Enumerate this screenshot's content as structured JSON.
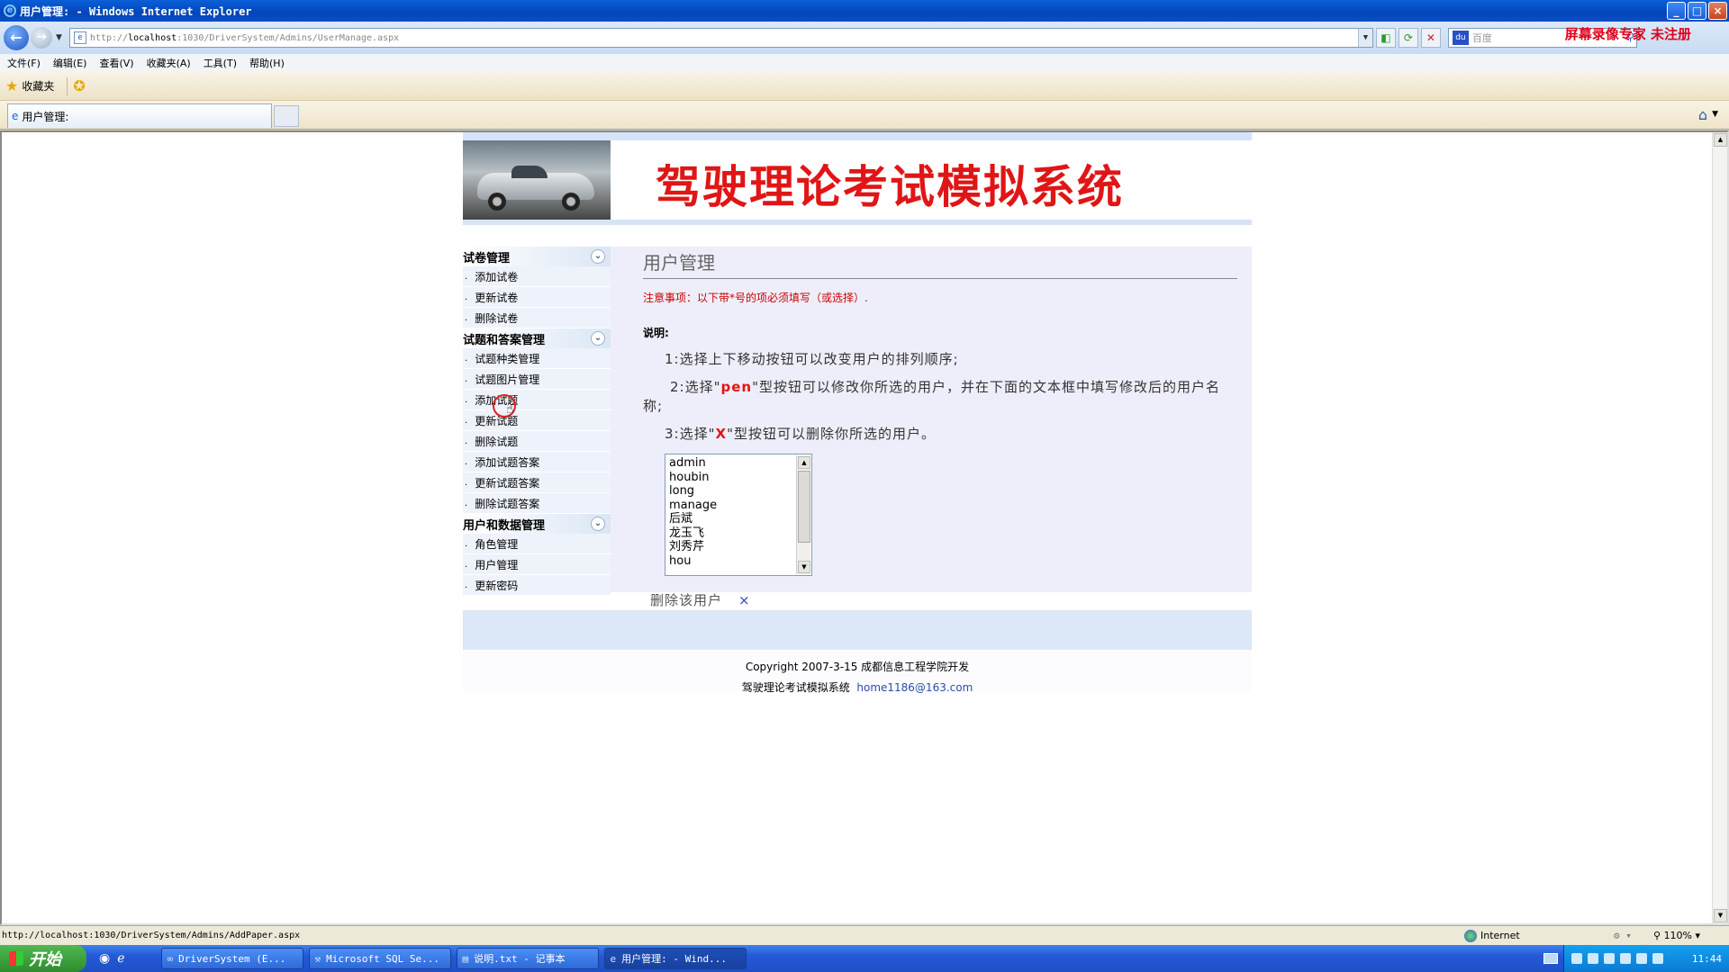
{
  "window": {
    "title": "用户管理: - Windows Internet Explorer",
    "controls": [
      "_",
      "□",
      "×"
    ]
  },
  "addressbar": {
    "url_prefix": "http://",
    "url_host": "localhost",
    "url_rest": ":1030/DriverSystem/Admins/UserManage.aspx",
    "search_placeholder": "百度",
    "watermark": "屏幕录像专家  未注册"
  },
  "menu": [
    "文件(F)",
    "编辑(E)",
    "查看(V)",
    "收藏夹(A)",
    "工具(T)",
    "帮助(H)"
  ],
  "favorites": {
    "label": "收藏夹"
  },
  "tab": {
    "label": "用户管理:"
  },
  "site": {
    "title": "驾驶理论考试模拟系统"
  },
  "sidebar": {
    "groups": [
      {
        "header": "试卷管理",
        "items": [
          "添加试卷",
          "更新试卷",
          "删除试卷"
        ]
      },
      {
        "header": "试题和答案管理",
        "items": [
          "试题种类管理",
          "试题图片管理",
          "添加试题",
          "更新试题",
          "删除试题",
          "添加试题答案",
          "更新试题答案",
          "删除试题答案"
        ]
      },
      {
        "header": "用户和数据管理",
        "items": [
          "角色管理",
          "用户管理",
          "更新密码"
        ]
      }
    ]
  },
  "content": {
    "heading": "用户管理",
    "notice": "注意事项：以下带*号的项必须填写（或选择）.",
    "desc_label": "说明:",
    "desc1": "1:选择上下移动按钮可以改变用户的排列顺序;",
    "desc2_pre": "2:选择\"",
    "desc2_key": "pen",
    "desc2_post": "\"型按钮可以修改你所选的用户，并在下面的文本框中填写修改后的用户名称;",
    "desc3_pre": "3:选择\"",
    "desc3_key": "X",
    "desc3_post": "\"型按钮可以删除你所选的用户。",
    "users": [
      "admin",
      "houbin",
      "long",
      "manage",
      "后斌",
      "龙玉飞",
      "刘秀芹",
      "hou"
    ],
    "delete_label": "删除该用户",
    "delete_icon": "×"
  },
  "footer": {
    "line1": "Copyright  2007-3-15 成都信息工程学院开发",
    "line2_text": "驾驶理论考试模拟系统",
    "email": "home1186@163.com"
  },
  "statusbar": {
    "url": "http://localhost:1030/DriverSystem/Admins/AddPaper.aspx",
    "zone": "Internet",
    "zoom": "110%"
  },
  "taskbar": {
    "start": "开始",
    "tasks": [
      {
        "label": "DriverSystem (E...",
        "active": false
      },
      {
        "label": "Microsoft SQL Se...",
        "active": false
      },
      {
        "label": "说明.txt - 记事本",
        "active": false
      },
      {
        "label": "用户管理: - Wind...",
        "active": true
      }
    ],
    "clock": "11:44"
  }
}
